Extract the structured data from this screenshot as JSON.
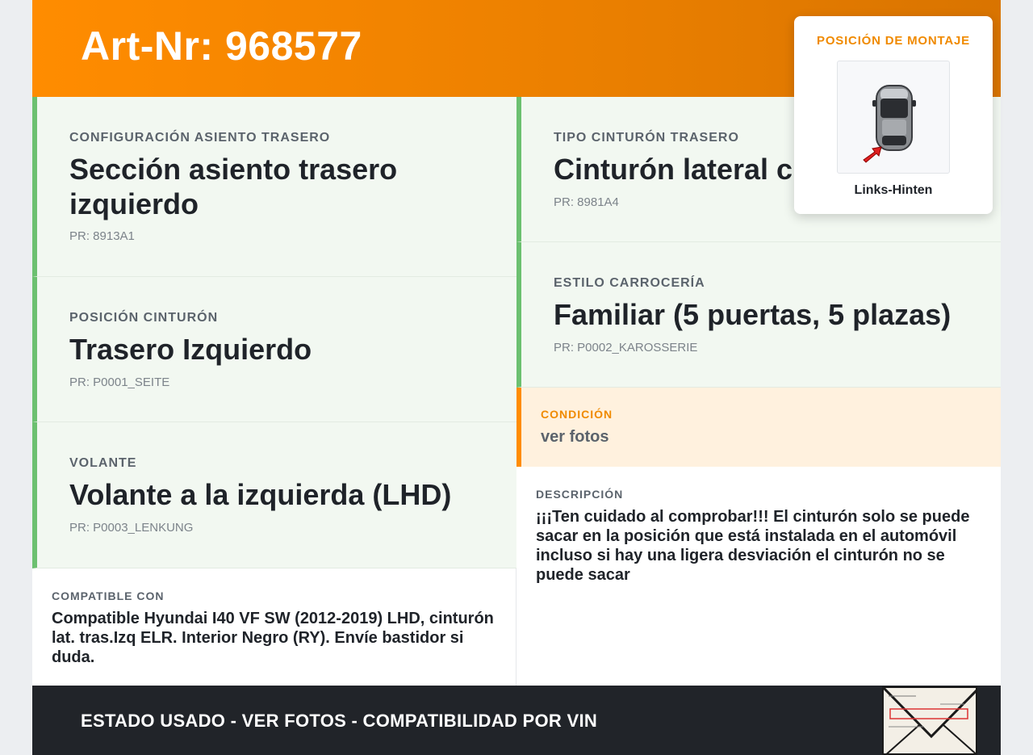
{
  "header": {
    "title": "Art-Nr: 968577"
  },
  "left_cards": [
    {
      "label": "CONFIGURACIÓN ASIENTO TRASERO",
      "value": "Sección asiento trasero izquierdo",
      "pr": "PR: 8913A1"
    },
    {
      "label": "POSICIÓN CINTURÓN",
      "value": "Trasero Izquierdo",
      "pr": "PR: P0001_SEITE"
    },
    {
      "label": "VOLANTE",
      "value": "Volante a la izquierda (LHD)",
      "pr": "PR: P0003_LENKUNG"
    }
  ],
  "right_cards": [
    {
      "label": "TIPO CINTURÓN TRASERO",
      "value": "Cinturón lateral c",
      "pr": "PR: 8981A4"
    },
    {
      "label": "ESTILO CARROCERÍA",
      "value": "Familiar (5 puertas, 5 plazas)",
      "pr": "PR: P0002_KAROSSERIE"
    }
  ],
  "condition": {
    "label": "CONDICIÓN",
    "value": "ver fotos"
  },
  "compatible": {
    "label": "COMPATIBLE CON",
    "text": "Compatible Hyundai I40 VF SW (2012-2019) LHD, cinturón lat. tras.Izq ELR. Interior Negro (RY). Envíe bastidor si duda."
  },
  "description": {
    "label": "DESCRIPCIÓN",
    "text": "¡¡¡Ten cuidado al comprobar!!! El cinturón solo se puede sacar en la posición que está instalada en el automóvil incluso si hay una ligera desviación el cinturón no se puede sacar"
  },
  "mounting": {
    "title": "POSICIÓN DE MONTAJE",
    "caption": "Links-Hinten",
    "icon": "car-top-view-icon"
  },
  "footer": {
    "text": "ESTADO USADO - VER FOTOS - COMPATIBILIDAD POR VIN",
    "thumbnail": "document-photo-thumbnail"
  },
  "colors": {
    "accent": "#ff8c00",
    "card_bg": "#f2f8f1",
    "card_border": "#6cc070",
    "footer_bg": "#212429",
    "condition_bg": "#fff1de"
  }
}
